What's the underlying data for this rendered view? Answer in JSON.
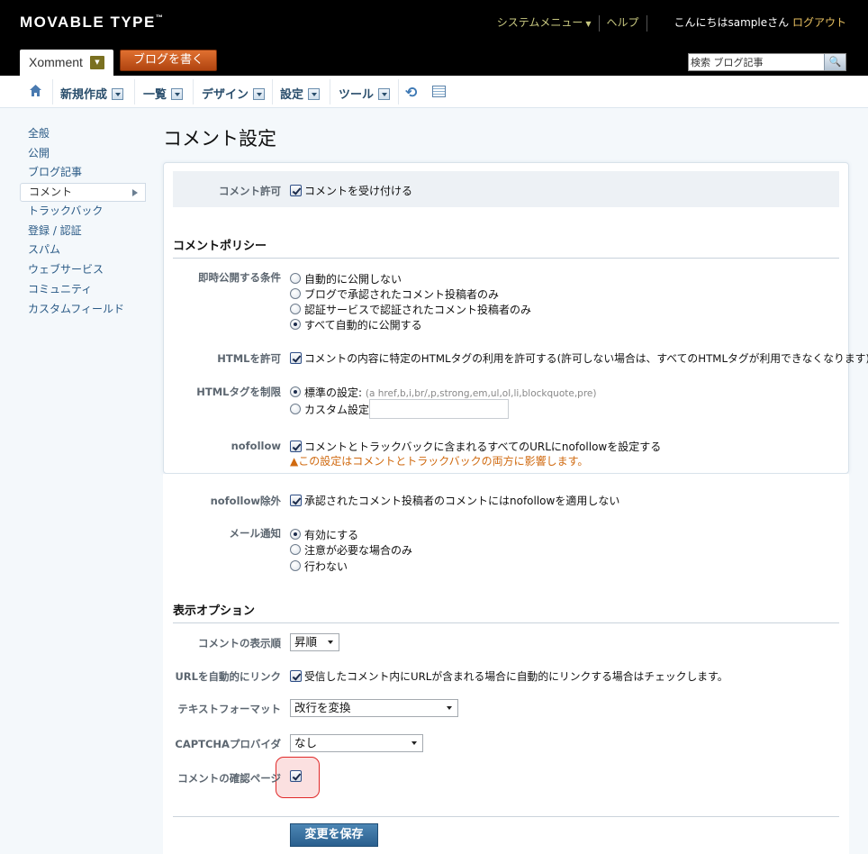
{
  "header": {
    "logo_text": "MOVABLE TYPE",
    "logo_tm": "™",
    "system_menu": "システムメニュー",
    "help": "ヘルプ",
    "greeting": "こんにちはsampleさん",
    "logout": "ログアウト",
    "blog_name": "Xomment",
    "write_blog": "ブログを書く",
    "search_value": "検索 ブログ記事"
  },
  "menubar": {
    "items": [
      "新規作成",
      "一覧",
      "デザイン",
      "設定",
      "ツール"
    ]
  },
  "sidebar": {
    "items": [
      "全般",
      "公開",
      "ブログ記事",
      "コメント",
      "トラックバック",
      "登録 / 認証",
      "スパム",
      "ウェブサービス",
      "コミュニティ",
      "カスタムフィールド"
    ],
    "active_index": 3
  },
  "page": {
    "title": "コメント設定"
  },
  "comment_permission": {
    "label": "コメント許可",
    "checkbox_label": "コメントを受け付ける",
    "checked": true
  },
  "policy": {
    "heading": "コメントポリシー",
    "immediate": {
      "label": "即時公開する条件",
      "options": [
        "自動的に公開しない",
        "ブログで承認されたコメント投稿者のみ",
        "認証サービスで認証されたコメント投稿者のみ",
        "すべて自動的に公開する"
      ],
      "selected_index": 3
    },
    "html_allow": {
      "label": "HTMLを許可",
      "checkbox_label": "コメントの内容に特定のHTMLタグの利用を許可する(許可しない場合は、すべてのHTMLタグが利用できなくなります)",
      "checked": true
    },
    "html_restrict": {
      "label": "HTMLタグを制限",
      "default_option": "標準の設定:",
      "default_hint": "(a href,b,i,br/,p,strong,em,ul,ol,li,blockquote,pre)",
      "custom_option": "カスタム設定:",
      "custom_value": "",
      "selected_index": 0
    },
    "nofollow": {
      "label": "nofollow",
      "checkbox_label": "コメントとトラックバックに含まれるすべてのURLにnofollowを設定する",
      "warning": "この設定はコメントとトラックバックの両方に影響します。",
      "checked": true
    },
    "nofollow_exclude": {
      "label": "nofollow除外",
      "checkbox_label": "承認されたコメント投稿者のコメントにはnofollowを適用しない",
      "checked": true
    },
    "mail_notify": {
      "label": "メール通知",
      "options": [
        "有効にする",
        "注意が必要な場合のみ",
        "行わない"
      ],
      "selected_index": 0
    }
  },
  "display": {
    "heading": "表示オプション",
    "order": {
      "label": "コメントの表示順",
      "value": "昇順"
    },
    "autolink": {
      "label": "URLを自動的にリンク",
      "checkbox_label": "受信したコメント内にURLが含まれる場合に自動的にリンクする場合はチェックします。",
      "checked": true
    },
    "text_format": {
      "label": "テキストフォーマット",
      "value": "改行を変換"
    },
    "captcha": {
      "label": "CAPTCHAプロバイダ",
      "value": "なし"
    },
    "confirm_page": {
      "label": "コメントの確認ページ",
      "checked": true
    }
  },
  "save_button": "変更を保存",
  "colors": {
    "header_bg": "#000000",
    "accent_orange": "#c8561a",
    "link_blue": "#2a5a86",
    "highlight_red": "#e02828"
  }
}
